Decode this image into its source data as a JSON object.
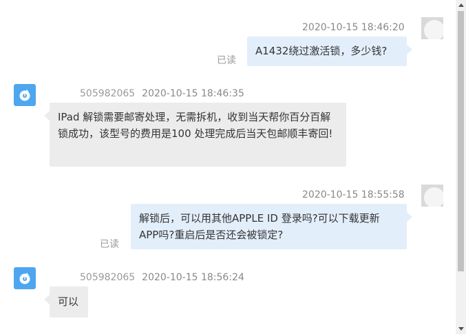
{
  "messages": [
    {
      "direction": "outgoing",
      "timestamp": "2020-10-15 18:46:20",
      "text": "A1432绕过激活锁，多少钱?",
      "read_status": "已读",
      "avatar": "self-avatar"
    },
    {
      "direction": "incoming",
      "sender": "505982065",
      "timestamp": "2020-10-15 18:46:35",
      "text": "IPad 解锁需要邮寄处理，无需拆机，收到当天帮你百分百解锁成功，该型号的费用是100 处理完成后当天包邮顺丰寄回!",
      "avatar": "peer-avatar"
    },
    {
      "direction": "outgoing",
      "timestamp": "2020-10-15 18:55:58",
      "text": "解锁后，可以用其他APPLE ID 登录吗?可以下载更新APP吗?重启后是否还会被锁定?",
      "read_status": "已读",
      "avatar": "self-avatar"
    },
    {
      "direction": "incoming",
      "sender": "505982065",
      "timestamp": "2020-10-15 18:56:24",
      "text": "可以",
      "avatar": "peer-avatar"
    }
  ],
  "colors": {
    "outgoing_bubble": "#e3eefb",
    "incoming_bubble": "#ececec",
    "peer_avatar": "#4ea6f0",
    "meta_text": "#888888"
  }
}
